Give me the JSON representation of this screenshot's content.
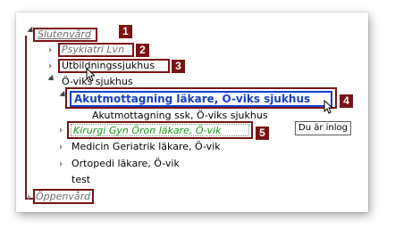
{
  "tree": {
    "items": [
      {
        "label": "Slutenvård"
      },
      {
        "label": "Psykiatri Lvn"
      },
      {
        "label": "Utbildningssjukhus"
      },
      {
        "label": "Ö-viks sjukhus"
      },
      {
        "label": "Akutmottagning läkare, Ö-viks sjukhus"
      },
      {
        "label": "Akutmottagning ssk, Ö-viks sjukhus"
      },
      {
        "label": "Kirurgi Gyn Öron läkare, Ö-vik"
      },
      {
        "label": "Medicin Geriatrik läkare, Ö-vik"
      },
      {
        "label": "Ortopedi läkare, Ö-vik"
      },
      {
        "label": "test"
      },
      {
        "label": "Öppenvård"
      }
    ]
  },
  "callouts": [
    "1",
    "2",
    "3",
    "4",
    "5"
  ],
  "tooltip": {
    "text": "Du är inlog"
  },
  "colors": {
    "callout": "#7b1212",
    "selected": "#1540c8",
    "active": "#1c9a1c"
  }
}
